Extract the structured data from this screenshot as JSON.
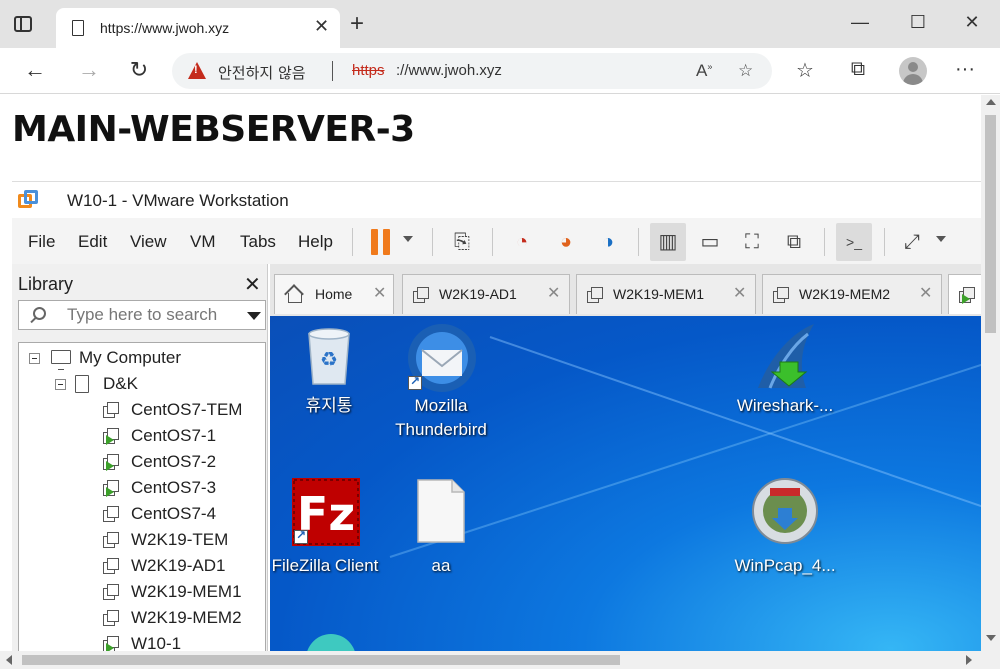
{
  "browser": {
    "tab_title": "https://www.jwoh.xyz",
    "tab_close": "✕",
    "new_tab": "+",
    "insecure_label": "안전하지 않음",
    "url_scheme": "https",
    "url_rest": "://www.jwoh.xyz",
    "window_minimize": "—",
    "window_maximize": "☐",
    "window_close": "✕",
    "back": "←",
    "forward": "→",
    "reload": "↻",
    "more": "···"
  },
  "page": {
    "title": "MAIN-WEBSERVER-3"
  },
  "vmware": {
    "window_title": "W10-1 - VMware Workstation",
    "menu": [
      "File",
      "Edit",
      "View",
      "VM",
      "Tabs",
      "Help"
    ],
    "library": {
      "title": "Library",
      "close": "✕",
      "search_placeholder": "Type here to search",
      "tree": [
        {
          "label": "My Computer",
          "level": 0,
          "icon": "pc-icon",
          "expanded": true
        },
        {
          "label": "D&K",
          "level": 1,
          "icon": "folder-icon",
          "expanded": true
        },
        {
          "label": "CentOS7-TEM",
          "level": 2,
          "icon": "vm-icon",
          "running": false
        },
        {
          "label": "CentOS7-1",
          "level": 2,
          "icon": "vm-icon",
          "running": true
        },
        {
          "label": "CentOS7-2",
          "level": 2,
          "icon": "vm-icon",
          "running": true
        },
        {
          "label": "CentOS7-3",
          "level": 2,
          "icon": "vm-icon",
          "running": true
        },
        {
          "label": "CentOS7-4",
          "level": 2,
          "icon": "vm-icon",
          "running": false
        },
        {
          "label": "W2K19-TEM",
          "level": 2,
          "icon": "vm-icon",
          "running": false
        },
        {
          "label": "W2K19-AD1",
          "level": 2,
          "icon": "vm-icon",
          "running": false
        },
        {
          "label": "W2K19-MEM1",
          "level": 2,
          "icon": "vm-icon",
          "running": false
        },
        {
          "label": "W2K19-MEM2",
          "level": 2,
          "icon": "vm-icon",
          "running": false
        },
        {
          "label": "W10-1",
          "level": 2,
          "icon": "vm-icon",
          "running": true
        }
      ]
    },
    "tabs": [
      {
        "label": "Home",
        "icon": "home-icon"
      },
      {
        "label": "W2K19-AD1",
        "icon": "vm-icon"
      },
      {
        "label": "W2K19-MEM1",
        "icon": "vm-icon"
      },
      {
        "label": "W2K19-MEM2",
        "icon": "vm-icon"
      }
    ],
    "tab_close": "✕",
    "desktop_icons": [
      {
        "name": "recycle-bin",
        "label": "휴지통"
      },
      {
        "name": "thunderbird",
        "label": "Mozilla Thunderbird"
      },
      {
        "name": "wireshark",
        "label": "Wireshark-..."
      },
      {
        "name": "filezilla",
        "label": "FileZilla Client"
      },
      {
        "name": "aa-file",
        "label": "aa"
      },
      {
        "name": "winpcap",
        "label": "WinPcap_4..."
      }
    ]
  },
  "colors": {
    "insecure": "#c42b1c",
    "pause": "#f07a1c",
    "running": "#3ca02a",
    "desktop": "#0d78e0"
  }
}
